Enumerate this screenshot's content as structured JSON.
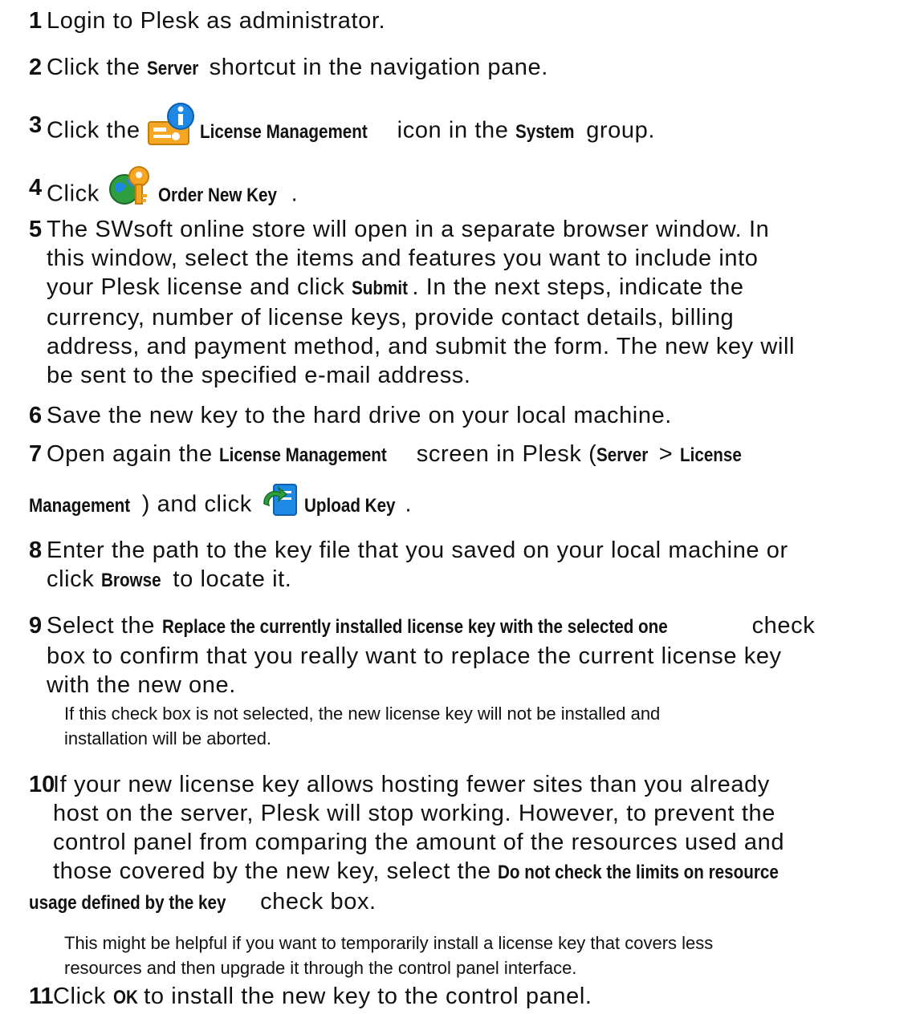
{
  "steps": [
    {
      "n": "1",
      "t1": "Login to Plesk as administrator."
    },
    {
      "n": "2",
      "t1": "Click the ",
      "b1": "Server",
      "t2": " shortcut in the navigation pane."
    },
    {
      "n": "3",
      "t1": "Click the ",
      "icon": "license-management-icon",
      "b1": "License Management",
      "t2": " icon in the ",
      "b2": "System",
      "t3": " group."
    },
    {
      "n": "4",
      "t1": "Click ",
      "icon": "order-new-key-icon",
      "b1": "Order New Key",
      "t2": "."
    },
    {
      "n": "5",
      "lines": [
        "The SWsoft online store will open in a separate browser window. In",
        "this window, select the items and features you want to include into",
        "currency, number of license keys, provide contact details, billing",
        "address, and payment method, and submit the form. The new key will",
        "be sent to the specified e-mail address."
      ],
      "l3a": "your Plesk license and click ",
      "l3b": "Submit",
      "l3c": ". In the next steps, indicate the"
    },
    {
      "n": "6",
      "t1": "Save the new key to the hard drive on your local machine."
    },
    {
      "n": "7",
      "t1": "Open again the ",
      "b1": "License Management",
      "t2": " screen in Plesk (",
      "b2": "Server",
      "t3": " > ",
      "b3": "License",
      "b4": "Management",
      "t4": ") and click ",
      "icon": "upload-key-icon",
      "b5": "Upload Key",
      "t5": "."
    },
    {
      "n": "8",
      "t1": "Enter the path to the key file that you saved on your local machine or",
      "t2": "click ",
      "b1": "Browse",
      "t3": " to locate it."
    },
    {
      "n": "9",
      "t1": "Select the ",
      "b1": "Replace the currently installed license key with the selected one",
      "t2": " check",
      "t3": "box to confirm that you really want to replace the current license key",
      "t4": "with the new one.",
      "note1": "If this check box is not selected, the new license key will not be installed and",
      "note2": "installation will be aborted."
    },
    {
      "n": "10",
      "l1": "If your new license key allows hosting fewer sites than you already",
      "l2": "host on the server, Plesk will stop working. However, to prevent the",
      "l3": "control panel from comparing the amount of the resources used and",
      "l4a": "those covered by the new key, select the ",
      "b1": "Do not check the limits on resource",
      "b2": "usage defined by the key",
      "l5": " check box.",
      "note1": "This might be helpful if you want to temporarily install a license key that covers less",
      "note2": "resources and then upgrade it through the control panel interface."
    },
    {
      "n": "11",
      "t1": "Click ",
      "b1": "OK",
      "t2": " to install the new key to the control panel."
    }
  ],
  "colors": {
    "text": "#111111",
    "icon_blue": "#1e88e5",
    "icon_orange": "#f5a623",
    "icon_green": "#2e9e3e"
  }
}
